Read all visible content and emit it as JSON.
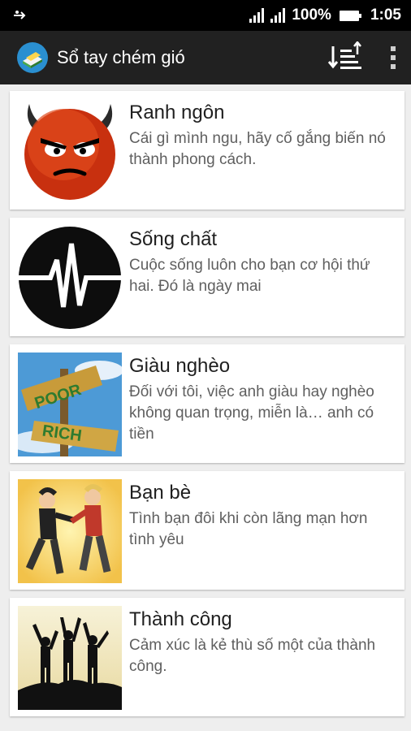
{
  "status": {
    "battery": "100%",
    "time": "1:05"
  },
  "app": {
    "title": "Sổ tay chém gió"
  },
  "icons": {
    "usb": "usb-icon",
    "signal": "signal-icon",
    "battery": "battery-icon",
    "app": "book-icon",
    "sort": "sort-icon",
    "menu": "overflow-menu-icon"
  },
  "colors": {
    "appbar": "#212121",
    "statusbar": "#000000",
    "background": "#eeeeee",
    "card": "#ffffff"
  },
  "items": [
    {
      "title": "Ranh ngôn",
      "desc": "Cái gì mình ngu, hãy cố gắng biến nó thành phong cách.",
      "image": "devil-face-icon"
    },
    {
      "title": "Sống chất",
      "desc": "Cuộc sống luôn cho bạn cơ hội thứ hai. Đó là ngày mai",
      "image": "heartbeat-icon"
    },
    {
      "title": "Giàu nghèo",
      "desc": "Đối với tôi, việc anh giàu hay nghèo không quan trọng, miễn là… anh có tiền",
      "image": "poor-rich-sign-image",
      "sign_top": "POOR",
      "sign_bottom": "RICH"
    },
    {
      "title": "Bạn bè",
      "desc": "Tình bạn đôi khi còn lãng mạn hơn tình yêu",
      "image": "friends-image"
    },
    {
      "title": "Thành công",
      "desc": "Cảm xúc là kẻ thù số một của thành công.",
      "image": "success-silhouette-image"
    }
  ]
}
